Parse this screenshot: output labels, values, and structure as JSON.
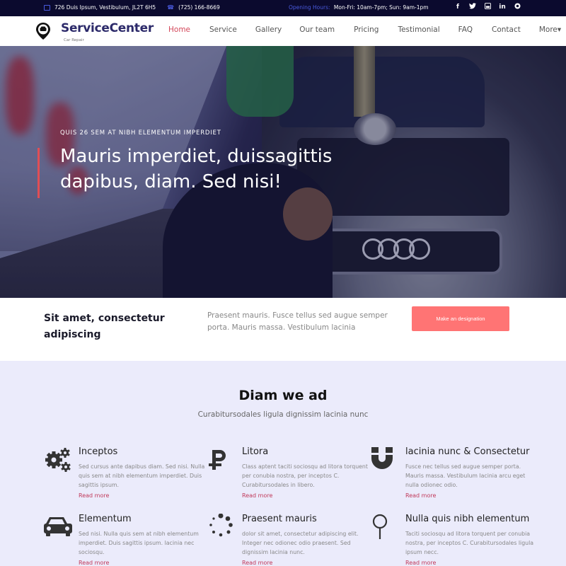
{
  "topbar": {
    "address": "726 Duis Ipsum, Vestibulum, JL2T 6H5",
    "phone": "(725) 166-8669",
    "hours_label": "Opening Hours:",
    "hours_value": "Mon-Fri: 10am-7pm; Sun: 9am-1pm",
    "social": [
      {
        "icon": "facebook-icon",
        "glyph": "f"
      },
      {
        "icon": "twitter-icon",
        "glyph": "t"
      },
      {
        "icon": "youtube-icon",
        "glyph": "▣"
      },
      {
        "icon": "linkedin-icon",
        "glyph": "in"
      },
      {
        "icon": "google-plus-icon",
        "glyph": "●"
      }
    ]
  },
  "header": {
    "brand": "ServiceCenter",
    "brand_sub": "Car Repair",
    "nav": [
      {
        "label": "Home",
        "active": true
      },
      {
        "label": "Service"
      },
      {
        "label": "Gallery"
      },
      {
        "label": "Our team"
      },
      {
        "label": "Pricing"
      },
      {
        "label": "Testimonial"
      },
      {
        "label": "FAQ"
      },
      {
        "label": "Contact"
      },
      {
        "label": "More▾"
      }
    ]
  },
  "hero": {
    "kicker": "QUIS 26 SEM AT NIBH ELEMENTUM IMPERDIET",
    "headline": "Mauris imperdiet, duissagittis dapibus, diam. Sed nisi!"
  },
  "cta": {
    "title": "Sit amet, consectetur adipiscing",
    "description": "Praesent mauris. Fusce tellus sed augue semper porta. Mauris massa. Vestibulum lacinia",
    "button": "Make an designation"
  },
  "features": {
    "heading": "Diam we ad",
    "subheading": "Curabitursodales ligula dignissim lacinia nunc",
    "read_more": "Read more",
    "items": [
      {
        "icon": "gears-icon",
        "title": "Inceptos",
        "text": "Sed cursus ante dapibus diam. Sed nisi. Nulla quis sem at nibh elementum imperdiet. Duis sagittis ipsum."
      },
      {
        "icon": "ruble-icon",
        "title": "Litora",
        "text": "Class aptent taciti sociosqu ad litora torquent per conubia nostra, per inceptos C. Curabitursodales in libero."
      },
      {
        "icon": "magnet-icon",
        "title": "lacinia nunc & Consectetur",
        "text": "Fusce nec tellus sed augue semper porta. Mauris massa. Vestibulum lacinia arcu eget nulla odionec odio."
      },
      {
        "icon": "car-icon",
        "title": "Elementum",
        "text": "Sed nisi. Nulla quis sem at nibh elementum imperdiet. Duis sagittis ipsum. lacinia nec sociosqu."
      },
      {
        "icon": "spinner-icon",
        "title": "Praesent mauris",
        "text": "dolor sit amet, consectetur adipiscing elit. Integer nec odionec odio praesent. Sed dignissim lacinia nunc."
      },
      {
        "icon": "pin-icon",
        "title": "Nulla quis nibh elementum",
        "text": "Taciti sociosqu ad litora torquent per conubia nostra, per inceptos C. Curabitursodales ligula ipsum necc."
      }
    ]
  }
}
